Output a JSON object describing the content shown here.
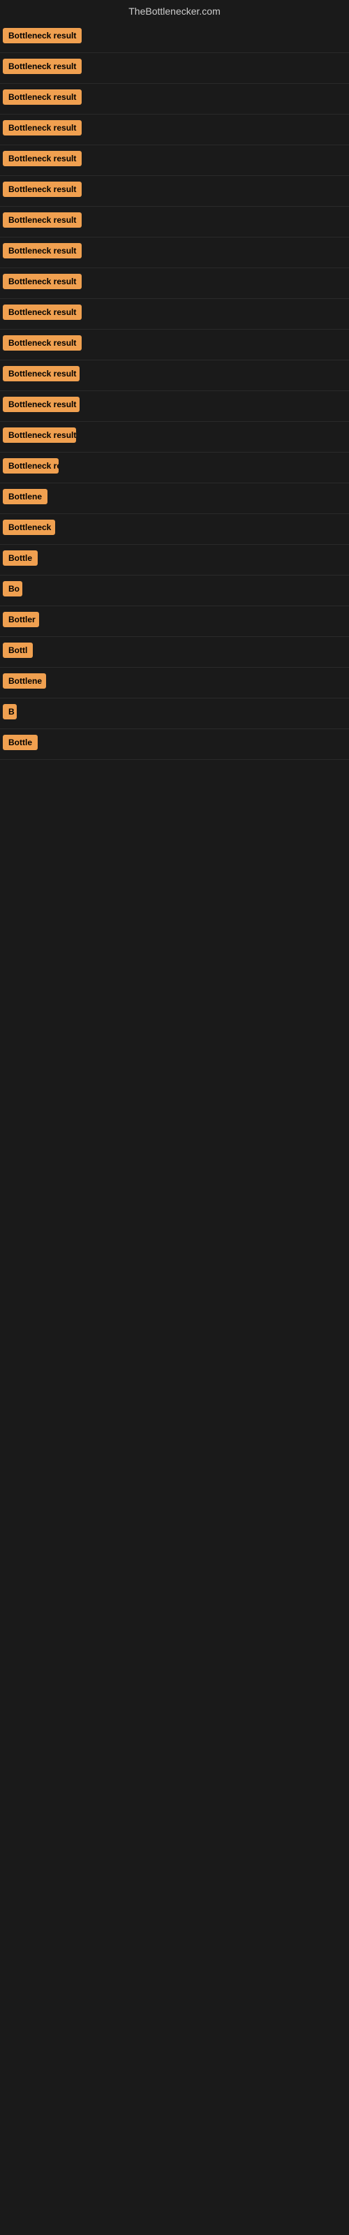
{
  "site": {
    "title": "TheBottlenecker.com"
  },
  "badges": [
    {
      "id": 1,
      "text": "Bottleneck result",
      "width": 120
    },
    {
      "id": 2,
      "text": "Bottleneck result",
      "width": 120
    },
    {
      "id": 3,
      "text": "Bottleneck result",
      "width": 120
    },
    {
      "id": 4,
      "text": "Bottleneck result",
      "width": 120
    },
    {
      "id": 5,
      "text": "Bottleneck result",
      "width": 120
    },
    {
      "id": 6,
      "text": "Bottleneck result",
      "width": 120
    },
    {
      "id": 7,
      "text": "Bottleneck result",
      "width": 120
    },
    {
      "id": 8,
      "text": "Bottleneck result",
      "width": 120
    },
    {
      "id": 9,
      "text": "Bottleneck result",
      "width": 120
    },
    {
      "id": 10,
      "text": "Bottleneck result",
      "width": 120
    },
    {
      "id": 11,
      "text": "Bottleneck result",
      "width": 120
    },
    {
      "id": 12,
      "text": "Bottleneck result",
      "width": 110
    },
    {
      "id": 13,
      "text": "Bottleneck result",
      "width": 110
    },
    {
      "id": 14,
      "text": "Bottleneck result",
      "width": 105
    },
    {
      "id": 15,
      "text": "Bottleneck re",
      "width": 80
    },
    {
      "id": 16,
      "text": "Bottlene",
      "width": 65
    },
    {
      "id": 17,
      "text": "Bottleneck",
      "width": 75
    },
    {
      "id": 18,
      "text": "Bottle",
      "width": 55
    },
    {
      "id": 19,
      "text": "Bo",
      "width": 28
    },
    {
      "id": 20,
      "text": "Bottler",
      "width": 52
    },
    {
      "id": 21,
      "text": "Bottl",
      "width": 45
    },
    {
      "id": 22,
      "text": "Bottlene",
      "width": 62
    },
    {
      "id": 23,
      "text": "B",
      "width": 20
    },
    {
      "id": 24,
      "text": "Bottle",
      "width": 50
    }
  ]
}
